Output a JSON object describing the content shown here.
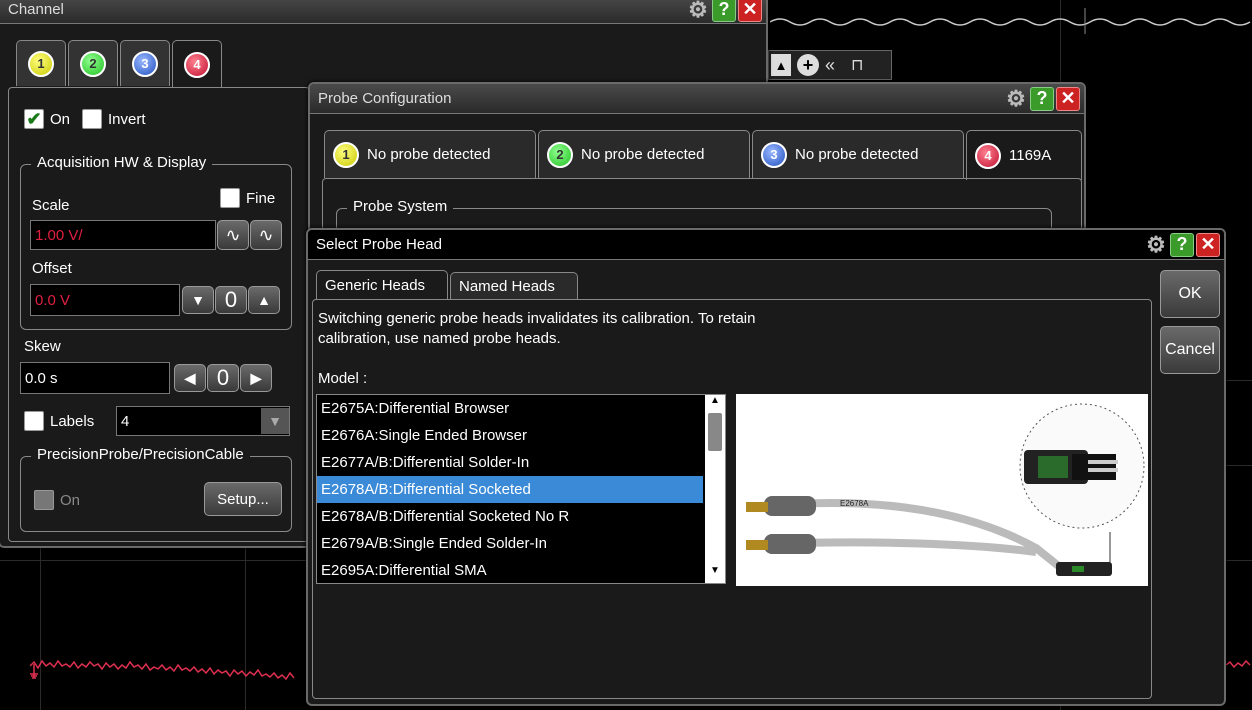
{
  "channel": {
    "title": "Channel",
    "tabs": [
      "1",
      "2",
      "3",
      "4"
    ],
    "on_label": "On",
    "invert_label": "Invert",
    "acq_group": "Acquisition HW & Display",
    "scale_label": "Scale",
    "fine_label": "Fine",
    "scale_value": "1.00 V/",
    "offset_label": "Offset",
    "offset_value": "0.0 V",
    "skew_label": "Skew",
    "skew_value": "0.0 s",
    "labels_label": "Labels",
    "labels_value": "4",
    "precision_group": "PrecisionProbe/PrecisionCable",
    "precision_on": "On",
    "setup_label": "Setup..."
  },
  "probe_config": {
    "title": "Probe Configuration",
    "tabs": [
      {
        "num": "1",
        "label": "No probe detected"
      },
      {
        "num": "2",
        "label": "No probe detected"
      },
      {
        "num": "3",
        "label": "No probe detected"
      },
      {
        "num": "4",
        "label": "1169A"
      }
    ],
    "probe_system_group": "Probe System"
  },
  "select_head": {
    "title": "Select Probe Head",
    "tabs": [
      "Generic Heads",
      "Named Heads"
    ],
    "message_line1": "Switching generic probe heads invalidates its calibration. To retain",
    "message_line2": "calibration, use named probe heads.",
    "model_label": "Model :",
    "models": [
      "E2675A:Differential Browser",
      "E2676A:Single Ended Browser",
      "E2677A/B:Differential Solder-In",
      "E2678A/B:Differential Socketed",
      "E2678A/B:Differential Socketed No R",
      "E2679A/B:Single Ended Solder-In",
      "E2695A:Differential SMA"
    ],
    "selected_index": 3,
    "probe_image_label": "E2678A",
    "ok_label": "OK",
    "cancel_label": "Cancel"
  },
  "colors": {
    "selection": "#3a8ad8",
    "value_red": "#e02040",
    "help_green": "#3a9a2a",
    "close_red": "#cc2222",
    "trace_red": "#e03050"
  },
  "toolbar": {
    "icons": [
      "chevron-up-icon",
      "zoom-icon",
      "double-chevron-left-icon",
      "pin-icon"
    ]
  }
}
